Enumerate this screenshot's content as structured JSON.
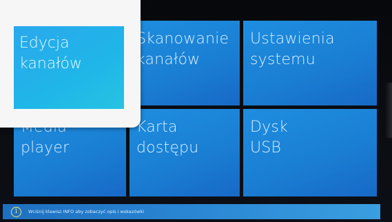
{
  "menu": {
    "tiles": [
      {
        "line1": "Edycja",
        "line2": "kanałów"
      },
      {
        "line1": "Skanowanie",
        "line2": "kanałów"
      },
      {
        "line1": "Ustawienia",
        "line2": "systemu"
      },
      {
        "line1": "Media",
        "line2": "player"
      },
      {
        "line1": "Karta",
        "line2": "dostępu"
      },
      {
        "line1": "Dysk",
        "line2": "USB"
      }
    ],
    "focused_index": 0
  },
  "status_bar": {
    "info_icon": "info-icon",
    "info_icon_glyph": "i",
    "hint": "Wciśnij klawisz INFO aby zobaczyć opis i wskazówki"
  },
  "colors": {
    "tile": "#1a7fd3",
    "focus_tile": "#1fb6e8",
    "focus_frame": "#f6f6f7",
    "status_bar": "#2a86d4",
    "icon_accent": "#f2e86a"
  }
}
